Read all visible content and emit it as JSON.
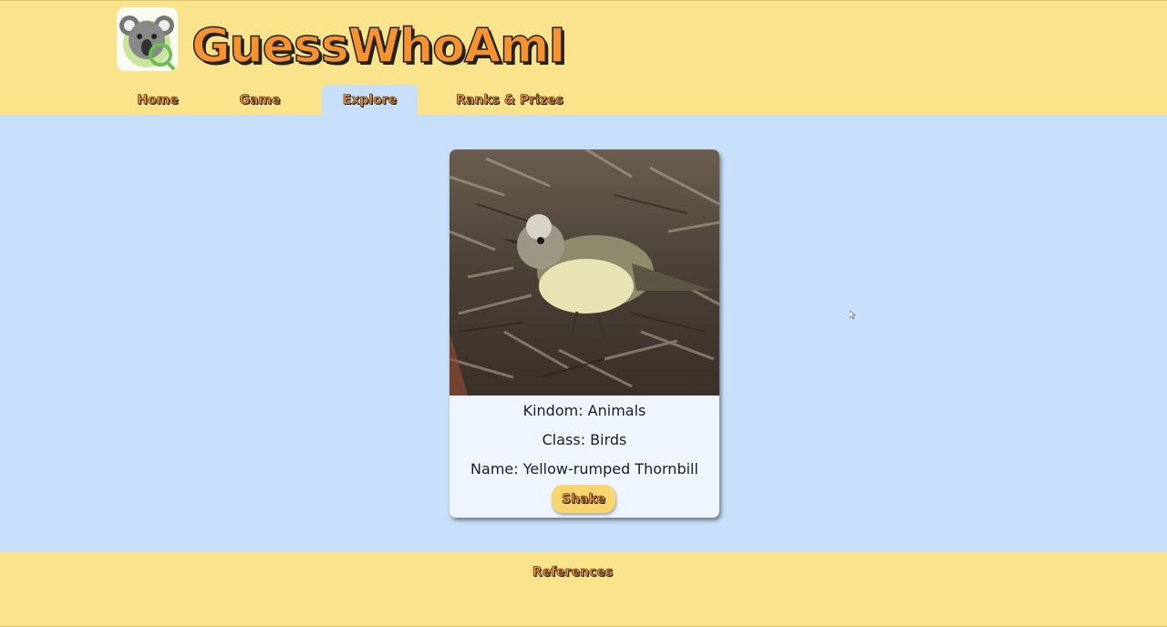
{
  "header": {
    "title": "GuessWhoAmI",
    "logo_icon": "koala-magnifier-icon",
    "nav": [
      {
        "label": "Home"
      },
      {
        "label": "Game"
      },
      {
        "label": "Explore",
        "active": true
      },
      {
        "label": "Ranks & Prizes"
      }
    ]
  },
  "card": {
    "kingdom": "Kindom: Animals",
    "class": "Class: Birds",
    "name": "Name: Yellow-rumped Thornbill",
    "shake_label": "Shake",
    "photo_icon": "bird-photo"
  },
  "footer": {
    "references_label": "References"
  },
  "colors": {
    "header_bg": "#f9e38b",
    "page_bg": "#c7dff8",
    "accent_orange": "#f7922e",
    "card_bg": "#eef5fe",
    "button_bg": "#f9d56e"
  }
}
